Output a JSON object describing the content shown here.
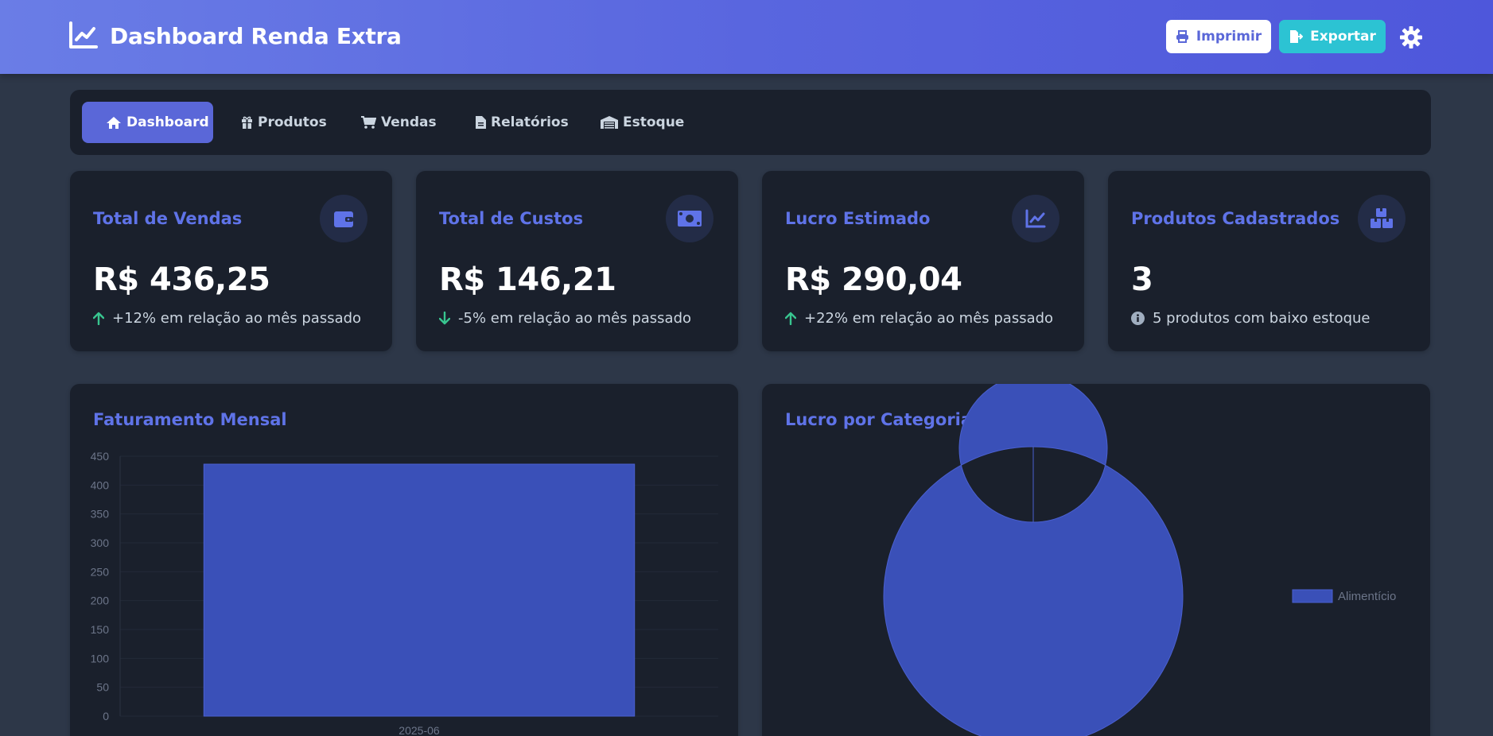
{
  "header": {
    "title": "Dashboard Renda Extra",
    "print_label": "Imprimir",
    "export_label": "Exportar",
    "brand_icon": "chart-line-icon",
    "settings_icon": "gear-icon"
  },
  "nav": {
    "items": [
      {
        "label": "Dashboard",
        "icon": "home-icon",
        "active": true
      },
      {
        "label": "Produtos",
        "icon": "gift-icon",
        "active": false
      },
      {
        "label": "Vendas",
        "icon": "cart-icon",
        "active": false
      },
      {
        "label": "Relatórios",
        "icon": "document-icon",
        "active": false
      },
      {
        "label": "Estoque",
        "icon": "warehouse-icon",
        "active": false
      }
    ]
  },
  "stats": [
    {
      "title": "Total de Vendas",
      "value": "R$ 436,25",
      "note": "+12% em relação ao mês passado",
      "trend": "up",
      "icon": "wallet-icon"
    },
    {
      "title": "Total de Custos",
      "value": "R$ 146,21",
      "note": "-5% em relação ao mês passado",
      "trend": "down",
      "icon": "money-bill-icon"
    },
    {
      "title": "Lucro Estimado",
      "value": "R$ 290,04",
      "note": "+22% em relação ao mês passado",
      "trend": "up",
      "icon": "chart-line-icon"
    },
    {
      "title": "Produtos Cadastrados",
      "value": "3",
      "note": "5 produtos com baixo estoque",
      "trend": "info",
      "icon": "boxes-icon"
    }
  ],
  "panels": {
    "revenue_title": "Faturamento Mensal",
    "profit_title": "Lucro por Categoria"
  },
  "colors": {
    "accent": "#5a67d8",
    "bar_fill": "#3a50b8",
    "bar_stroke": "#4a60d0",
    "up": "#38c58f",
    "export": "#2cc3d3"
  },
  "chart_data": [
    {
      "type": "bar",
      "title": "Faturamento Mensal",
      "categories": [
        "2025-06"
      ],
      "values": [
        436.25
      ],
      "ylim": [
        0,
        450
      ],
      "yticks": [
        0,
        50,
        100,
        150,
        200,
        250,
        300,
        350,
        400,
        450
      ],
      "grid": true
    },
    {
      "type": "pie",
      "title": "Lucro por Categoria",
      "labels": [
        "Alimentício"
      ],
      "values": [
        290.04
      ],
      "legend": "right"
    }
  ]
}
